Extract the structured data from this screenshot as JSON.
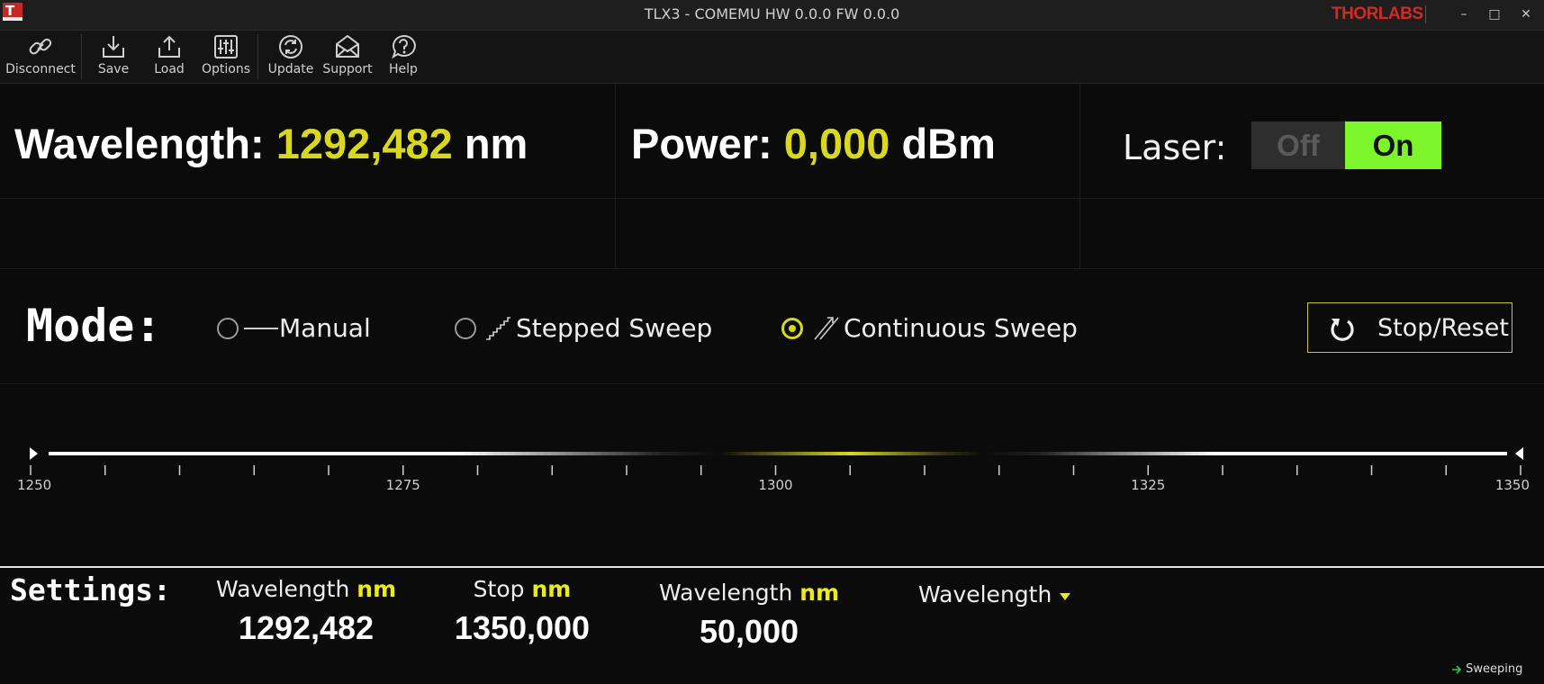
{
  "window": {
    "title": "TLX3 - COMEMU HW 0.0.0 FW 0.0.0",
    "brand": "THORLABS",
    "app_icon_letter": "T",
    "controls": {
      "minimize": "–",
      "maximize": "□",
      "close": "✕"
    }
  },
  "toolbar": [
    {
      "label": "Disconnect",
      "icon": "link-icon"
    },
    {
      "label": "Save",
      "icon": "save-icon"
    },
    {
      "label": "Load",
      "icon": "load-icon"
    },
    {
      "label": "Options",
      "icon": "sliders-icon"
    },
    {
      "label": "Update",
      "icon": "refresh-icon"
    },
    {
      "label": "Support",
      "icon": "envelope-icon"
    },
    {
      "label": "Help",
      "icon": "help-icon"
    }
  ],
  "readouts": {
    "wavelength": {
      "label": "Wavelength:",
      "value": "1292,482",
      "unit": "nm"
    },
    "power": {
      "label": "Power:",
      "value": "0,000",
      "unit": "dBm"
    },
    "laser": {
      "label": "Laser:",
      "off": "Off",
      "on": "On",
      "state": "On"
    }
  },
  "mode": {
    "label": "Mode:",
    "options": [
      {
        "label": "Manual",
        "selected": false
      },
      {
        "label": "Stepped Sweep",
        "selected": false
      },
      {
        "label": "Continuous Sweep",
        "selected": true
      }
    ],
    "stop_reset": "Stop/Reset"
  },
  "scale": {
    "min": 1250,
    "max": 1350,
    "major_labels": [
      "1250",
      "1275",
      "1300",
      "1325",
      "1350"
    ],
    "current_wavelength": 1292.482
  },
  "settings": {
    "label": "Settings:",
    "columns": [
      {
        "head": "Wavelength",
        "unit": "nm",
        "value": "1292,482"
      },
      {
        "head": "Stop",
        "unit": "nm",
        "value": "1350,000"
      },
      {
        "head": "Wavelength",
        "unit": "nm",
        "value": "50,000"
      }
    ],
    "dropdown": "Wavelength"
  },
  "status": "Sweeping",
  "colors": {
    "accent": "#d8d820",
    "laser_on": "#7cf52a",
    "brand": "#d42a25"
  }
}
